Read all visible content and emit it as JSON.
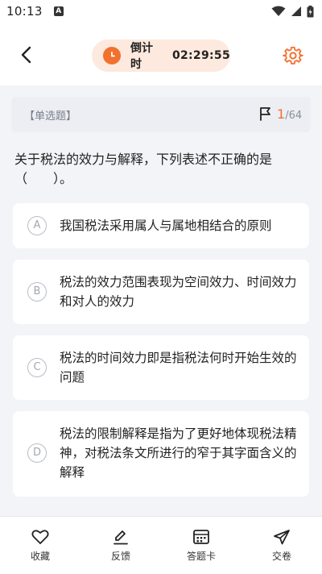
{
  "status_bar": {
    "time": "10:13",
    "notification_letter": "A"
  },
  "header": {
    "timer_label": "倒计时",
    "timer_value": "02:29:55",
    "accent_color": "#f2712e",
    "pill_color": "#fde9dd"
  },
  "question_bar": {
    "type": "【单选题】",
    "current": "1",
    "total": "/64"
  },
  "question": {
    "text": "关于税法的效力与解释，下列表述不正确的是（　　）。",
    "options": [
      {
        "letter": "A",
        "text": "我国税法采用属人与属地相结合的原则"
      },
      {
        "letter": "B",
        "text": "税法的效力范围表现为空间效力、时间效力和对人的效力"
      },
      {
        "letter": "C",
        "text": "税法的时间效力即是指税法何时开始生效的问题"
      },
      {
        "letter": "D",
        "text": "税法的限制解释是指为了更好地体现税法精神，对税法条文所进行的窄于其字面含义的解释"
      }
    ]
  },
  "bottom_nav": {
    "items": [
      {
        "label": "收藏",
        "icon": "heart-icon"
      },
      {
        "label": "反馈",
        "icon": "edit-icon"
      },
      {
        "label": "答题卡",
        "icon": "calendar-icon"
      },
      {
        "label": "交卷",
        "icon": "send-icon"
      }
    ]
  }
}
